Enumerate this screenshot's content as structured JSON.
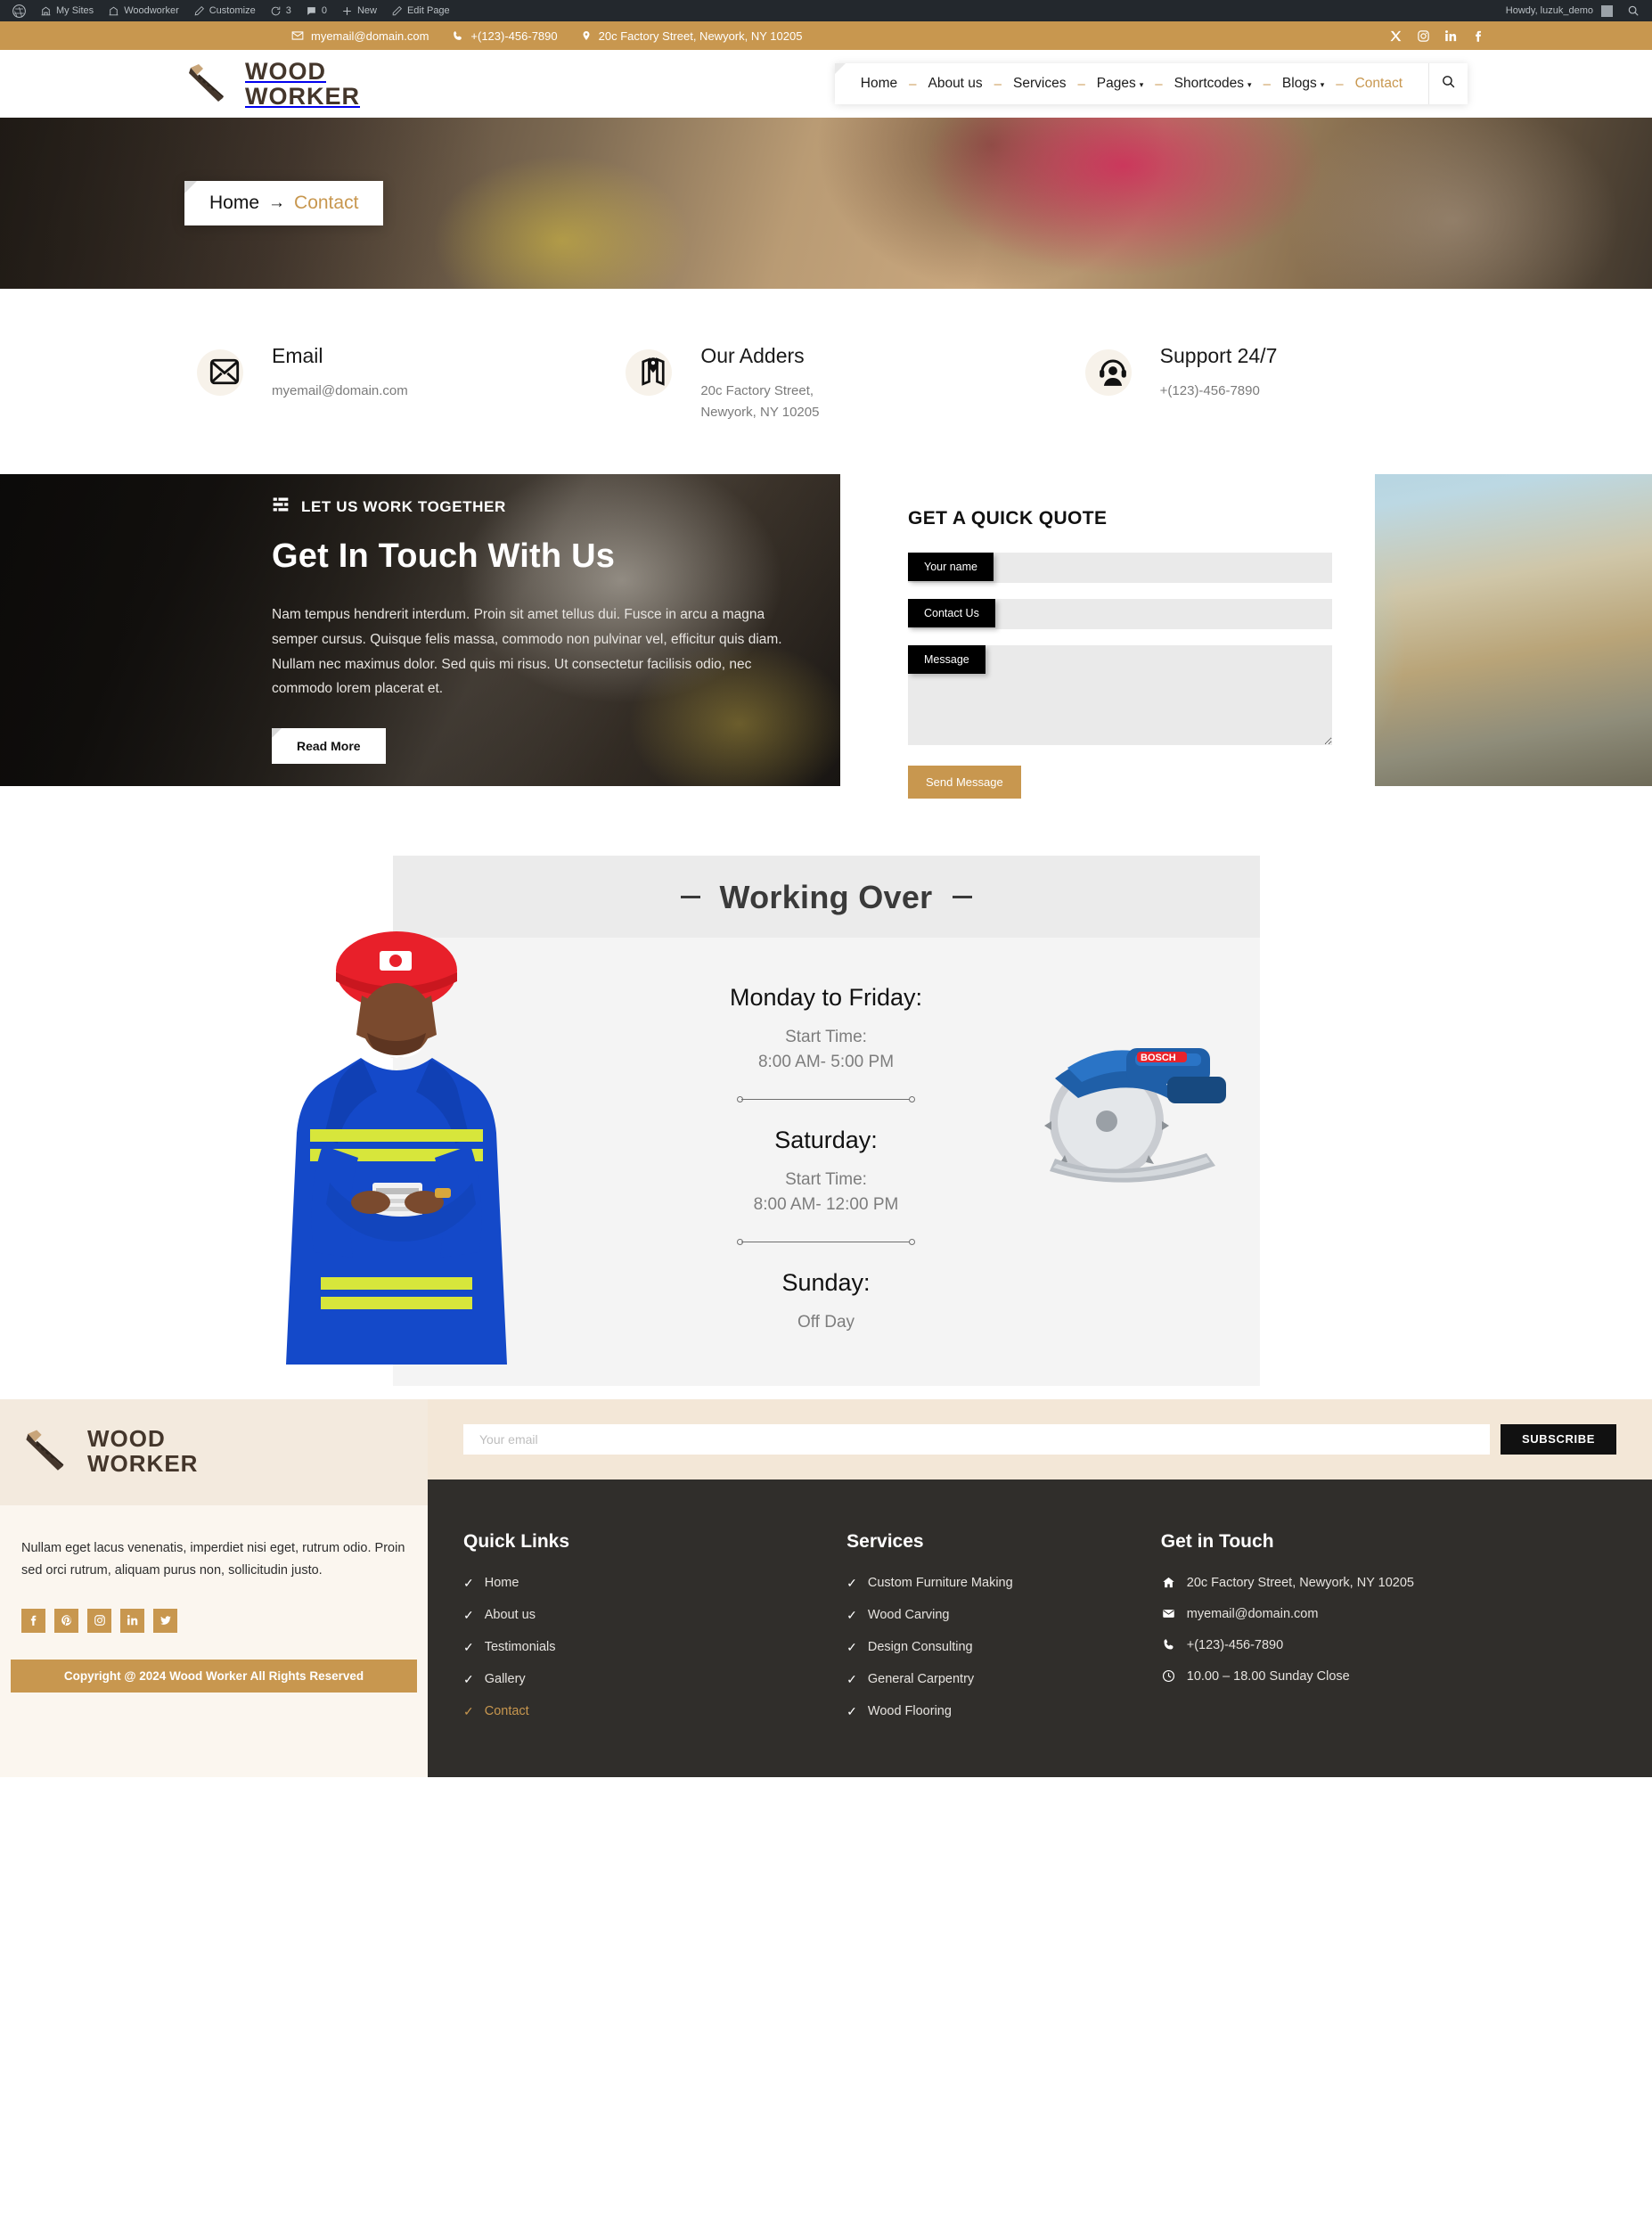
{
  "admin_bar": {
    "items": [
      {
        "icon": "wordpress-icon",
        "label": ""
      },
      {
        "icon": "dashboard-icon",
        "label": "My Sites"
      },
      {
        "icon": "site-icon",
        "label": "Woodworker"
      },
      {
        "icon": "brush-icon",
        "label": "Customize"
      },
      {
        "icon": "refresh-icon",
        "label": "3"
      },
      {
        "icon": "comment-icon",
        "label": "0"
      },
      {
        "icon": "plus-icon",
        "label": "New"
      },
      {
        "icon": "pencil-icon",
        "label": "Edit Page"
      }
    ],
    "greeting": "Howdy, luzuk_demo",
    "search_icon": "search-icon"
  },
  "topbar": {
    "email": "myemail@domain.com",
    "phone": "+(123)-456-7890",
    "address": "20c Factory Street, Newyork, NY 10205",
    "socials": [
      "x-icon",
      "instagram-icon",
      "linkedin-icon",
      "facebook-icon"
    ],
    "bg_color": "#c8974f"
  },
  "header": {
    "logo_line1": "WOOD",
    "logo_line2": "WORKER",
    "logo_icon": "saw-icon",
    "nav": [
      {
        "label": "Home",
        "has_caret": false,
        "active": false
      },
      {
        "label": "About us",
        "has_caret": false,
        "active": false
      },
      {
        "label": "Services",
        "has_caret": false,
        "active": false
      },
      {
        "label": "Pages",
        "has_caret": true,
        "active": false
      },
      {
        "label": "Shortcodes",
        "has_caret": true,
        "active": false
      },
      {
        "label": "Blogs",
        "has_caret": true,
        "active": false
      },
      {
        "label": "Contact",
        "has_caret": false,
        "active": true
      }
    ],
    "search_icon": "search-icon",
    "accent_color": "#c8974f"
  },
  "hero": {
    "breadcrumb_home": "Home",
    "breadcrumb_arrow": "→",
    "breadcrumb_current": "Contact"
  },
  "info_cards": [
    {
      "icon": "envelope-icon",
      "title": "Email",
      "line1": "myemail@domain.com",
      "line2": ""
    },
    {
      "icon": "map-pin-icon",
      "title": "Our Adders",
      "line1": "20c Factory Street,",
      "line2": "Newyork, NY 10205"
    },
    {
      "icon": "headset-support-icon",
      "title": "Support 24/7",
      "line1": "+(123)-456-7890",
      "line2": ""
    }
  ],
  "quote": {
    "eyebrow": "LET US WORK TOGETHER",
    "eyebrow_icon": "bars-icon",
    "heading": "Get In Touch With Us",
    "paragraph": "Nam tempus hendrerit interdum. Proin sit amet tellus dui. Fusce in arcu a magna semper cursus. Quisque felis massa, commodo non pulvinar vel, efficitur quis diam. Nullam nec maximus dolor. Sed quis mi risus. Ut consectetur facilisis odio, nec commodo lorem placerat et.",
    "read_more": "Read More",
    "form_title": "GET A QUICK QUOTE",
    "fields": [
      {
        "label": "Your name",
        "value": "",
        "placeholder": ""
      },
      {
        "label": "Contact Us",
        "value": "",
        "placeholder": ""
      },
      {
        "label": "Message",
        "value": "",
        "placeholder": ""
      }
    ],
    "submit_label": "Send Message",
    "submit_color": "#c8974f"
  },
  "hours": {
    "title": "Working Over",
    "entries": [
      {
        "day": "Monday to Friday:",
        "label": "Start Time:",
        "time": "8:00 AM- 5:00 PM"
      },
      {
        "day": "Saturday:",
        "label": "Start Time:",
        "time": "8:00 AM- 12:00 PM"
      },
      {
        "day": "Sunday:",
        "label": "",
        "time": "Off Day"
      }
    ]
  },
  "footer": {
    "logo_line1": "WOOD",
    "logo_line2": "WORKER",
    "logo_icon": "saw-icon",
    "description": "Nullam eget lacus venenatis, imperdiet nisi eget, rutrum odio. Proin sed orci rutrum, aliquam purus non, sollicitudin justo.",
    "socials": [
      "facebook-icon",
      "pinterest-icon",
      "instagram-icon",
      "linkedin-icon",
      "twitter-icon"
    ],
    "copyright": "Copyright @ 2024 Wood Worker All Rights Reserved",
    "newsletter": {
      "placeholder": "Your email",
      "value": "",
      "button": "SUBSCRIBE"
    },
    "columns": [
      {
        "title": "Quick Links",
        "items": [
          {
            "label": "Home",
            "gold": false
          },
          {
            "label": "About us",
            "gold": false
          },
          {
            "label": "Testimonials",
            "gold": false
          },
          {
            "label": "Gallery",
            "gold": false
          },
          {
            "label": "Contact",
            "gold": true
          }
        ]
      },
      {
        "title": "Services",
        "items": [
          {
            "label": "Custom Furniture Making",
            "gold": false
          },
          {
            "label": "Wood Carving",
            "gold": false
          },
          {
            "label": "Design Consulting",
            "gold": false
          },
          {
            "label": "General Carpentry",
            "gold": false
          },
          {
            "label": "Wood Flooring",
            "gold": false
          }
        ]
      }
    ],
    "contact_title": "Get in Touch",
    "contact_items": [
      {
        "icon": "home-icon",
        "label": "20c Factory Street, Newyork, NY 10205"
      },
      {
        "icon": "envelope-icon",
        "label": "myemail@domain.com"
      },
      {
        "icon": "phone-icon",
        "label": "+(123)-456-7890"
      },
      {
        "icon": "clock-icon",
        "label": "10.00 – 18.00 Sunday Close"
      }
    ]
  }
}
